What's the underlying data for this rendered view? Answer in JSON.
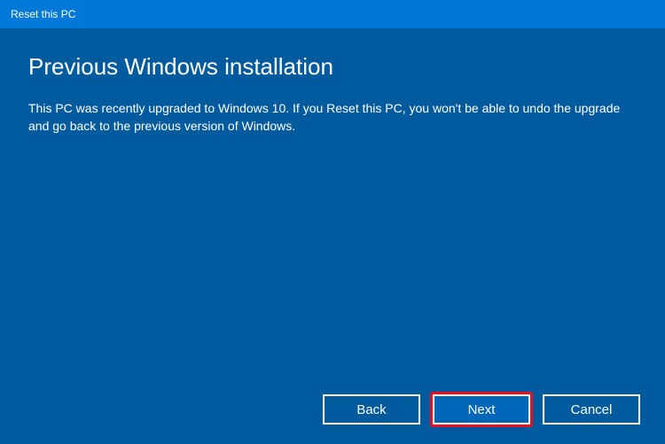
{
  "titlebar": {
    "title": "Reset this PC"
  },
  "content": {
    "heading": "Previous Windows installation",
    "body": "This PC was recently upgraded to Windows 10. If you Reset this PC, you won't be able to undo the upgrade and go back to the previous version of Windows."
  },
  "buttons": {
    "back": "Back",
    "next": "Next",
    "cancel": "Cancel"
  }
}
